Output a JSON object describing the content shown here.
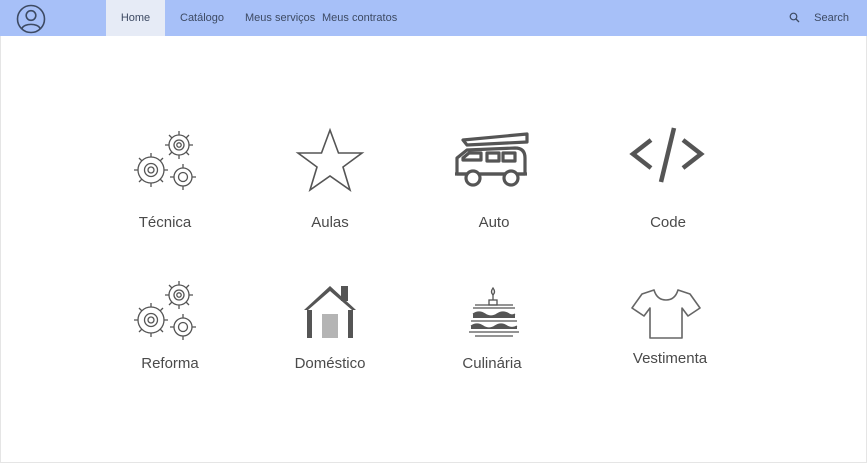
{
  "navbar": {
    "items": [
      {
        "label": "Home"
      },
      {
        "label": "Catálogo"
      },
      {
        "label": "Meus serviços"
      },
      {
        "label": "Meus contratos"
      }
    ],
    "search_label": "Search"
  },
  "categories": [
    {
      "label": "Técnica",
      "icon": "gears-icon"
    },
    {
      "label": "Aulas",
      "icon": "star-icon"
    },
    {
      "label": "Auto",
      "icon": "camper-van-icon"
    },
    {
      "label": "Code",
      "icon": "code-icon"
    },
    {
      "label": "Reforma",
      "icon": "gears-icon"
    },
    {
      "label": "Doméstico",
      "icon": "house-icon"
    },
    {
      "label": "Culinária",
      "icon": "cake-icon"
    },
    {
      "label": "Vestimenta",
      "icon": "tshirt-icon"
    }
  ],
  "colors": {
    "navbar": "#a7c0f8",
    "active_tab": "#e6ebf6",
    "icon": "#555555",
    "text": "#4a4a4a"
  }
}
